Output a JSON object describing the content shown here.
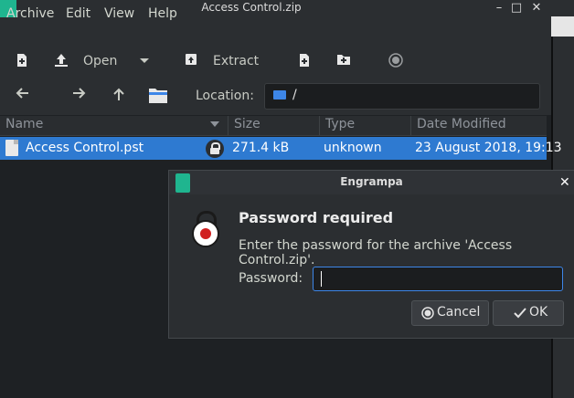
{
  "window": {
    "title": "Access Control.zip",
    "minimize_glyph": "–",
    "maximize_glyph": "□",
    "close_glyph": "✕"
  },
  "menubar": {
    "items": [
      "Archive",
      "Edit",
      "View",
      "Help"
    ]
  },
  "toolbar": {
    "open_label": "Open",
    "extract_label": "Extract"
  },
  "location": {
    "label": "Location:",
    "path": "/"
  },
  "columns": {
    "name": "Name",
    "size": "Size",
    "type": "Type",
    "date": "Date Modified"
  },
  "file_row": {
    "name": "Access Control.pst",
    "size": "271.4 kB",
    "type": "unknown",
    "date": "23 August 2018, 19:13"
  },
  "dialog": {
    "title": "Engrampa",
    "close_glyph": "✕",
    "heading": "Password required",
    "message": "Enter the password for the archive 'Access Control.zip'.",
    "password_label": "Password:",
    "password_value": "",
    "cancel_label": "Cancel",
    "ok_label": "OK"
  },
  "colors": {
    "accent": "#2e7ad1",
    "app_icon": "#1fb58f",
    "background": "#1e2124"
  }
}
